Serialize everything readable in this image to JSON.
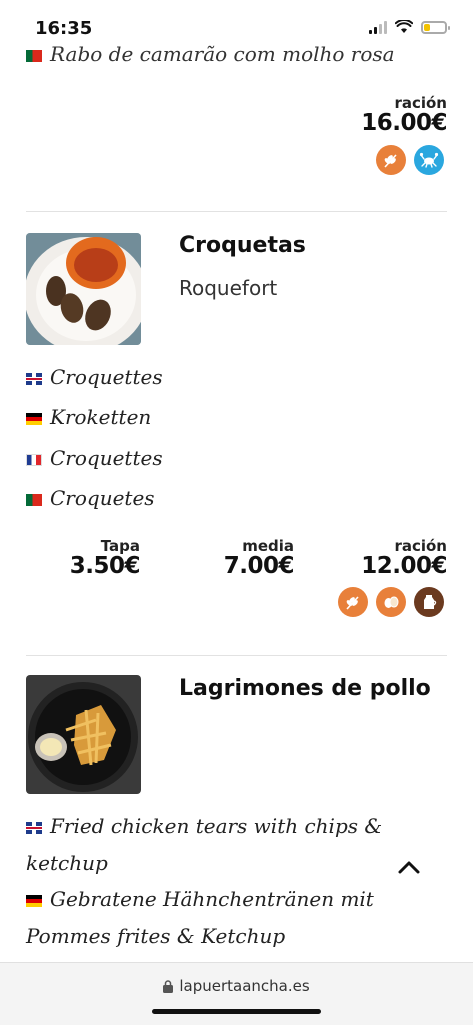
{
  "status": {
    "time": "16:35"
  },
  "top_item": {
    "partial_translation": "Rabo de camarão com molho rosa",
    "price": {
      "label": "ración",
      "value": "16.00€"
    },
    "allergens": [
      "gluten-icon",
      "crustacean-icon"
    ]
  },
  "dishes": [
    {
      "title": "Croquetas",
      "subtitle": "Roquefort",
      "translations": [
        {
          "lang": "en",
          "text": "Croquettes"
        },
        {
          "lang": "de",
          "text": "Kroketten"
        },
        {
          "lang": "fr",
          "text": "Croquettes"
        },
        {
          "lang": "pt",
          "text": "Croquetes"
        }
      ],
      "prices": [
        {
          "label": "Tapa",
          "value": "3.50€"
        },
        {
          "label": "media",
          "value": "7.00€"
        },
        {
          "label": "ración",
          "value": "12.00€"
        }
      ],
      "allergens": [
        "gluten-icon",
        "egg-icon",
        "milk-icon"
      ]
    },
    {
      "title": "Lagrimones de pollo",
      "translations": [
        {
          "lang": "en",
          "text": "Fried chicken tears with chips & ketchup"
        },
        {
          "lang": "de",
          "text": "Gebratene Hähnchentränen mit Pommes frites & Ketchup"
        }
      ]
    }
  ],
  "browser": {
    "url": "lapuertaancha.es"
  },
  "colors": {
    "gluten": "#e8803a",
    "crustacean": "#2aa7df",
    "egg": "#e8803a",
    "milk": "#6b3a1f"
  }
}
